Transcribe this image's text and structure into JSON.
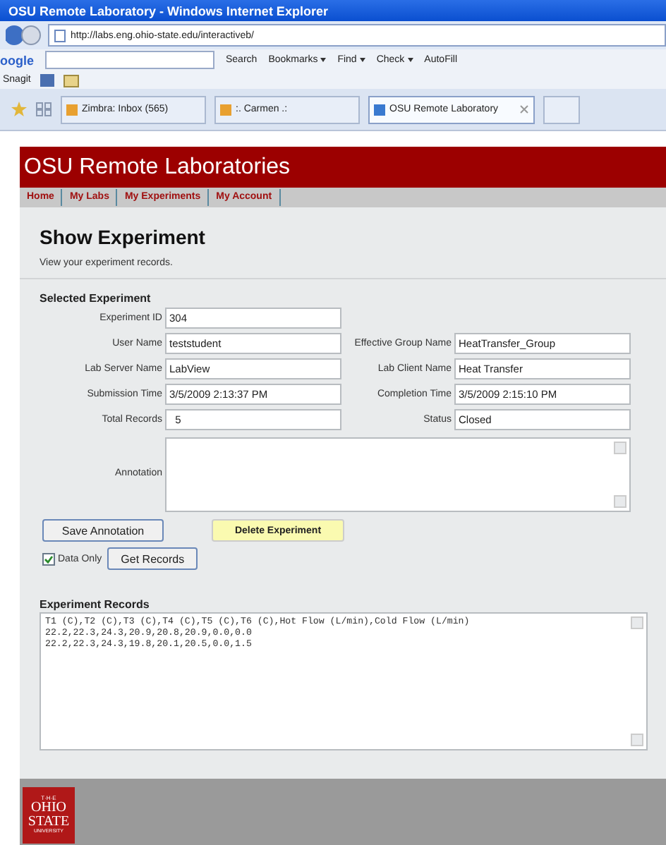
{
  "window": {
    "title": "OSU Remote Laboratory - Windows Internet Explorer"
  },
  "address_bar": {
    "url": "http://labs.eng.ohio-state.edu/interactiveb/"
  },
  "google_toolbar": {
    "logo": "oogle",
    "items": [
      {
        "label": "Search",
        "menu": false
      },
      {
        "label": "Bookmarks",
        "menu": true
      },
      {
        "label": "Find",
        "menu": true
      },
      {
        "label": "Check",
        "menu": true
      },
      {
        "label": "AutoFill",
        "menu": false
      }
    ]
  },
  "links_bar": {
    "items": [
      "Snagit"
    ]
  },
  "browser_tabs": [
    {
      "label": "Zimbra: Inbox (565)",
      "selected": false
    },
    {
      "label": ":. Carmen .:",
      "selected": false
    },
    {
      "label": "OSU Remote Laboratory",
      "selected": true
    }
  ],
  "site": {
    "title": "OSU Remote Laboratories",
    "nav": [
      "Home",
      "My Labs",
      "My Experiments",
      "My Account"
    ]
  },
  "page": {
    "heading": "Show Experiment",
    "description": "View your experiment records.",
    "section": "Selected Experiment",
    "rows": [
      [
        {
          "label": "Experiment ID",
          "value": "304"
        }
      ],
      [
        {
          "label": "User Name",
          "value": "teststudent"
        },
        {
          "label": "Effective Group Name",
          "value": "HeatTransfer_Group"
        }
      ],
      [
        {
          "label": "Lab Server Name",
          "value": "LabView"
        },
        {
          "label": "Lab Client Name",
          "value": "Heat Transfer"
        }
      ],
      [
        {
          "label": "Submission Time",
          "value": "3/5/2009 2:13:37 PM"
        },
        {
          "label": "Completion Time",
          "value": "3/5/2009 2:15:10 PM"
        }
      ],
      [
        {
          "label": "Total Records",
          "value": "  5"
        },
        {
          "label": "Status",
          "value": "Closed"
        }
      ]
    ],
    "annotation": {
      "label": "Annotation"
    },
    "buttons": [
      {
        "label": "Save Annotation",
        "kind": "normal"
      },
      {
        "label": "Delete Experiment",
        "kind": "warning"
      }
    ],
    "data_only": {
      "label": "Data Only",
      "checked": true
    },
    "get_records": {
      "label": "Get Records"
    },
    "records": {
      "heading": "Experiment Records",
      "lines": [
        "T1 (C),T2 (C),T3 (C),T4 (C),T5 (C),T6 (C),Hot Flow (L/min),Cold Flow (L/min)",
        "22.2,22.3,24.3,20.9,20.8,20.9,0.0,0.0",
        "22.2,22.3,24.3,19.8,20.1,20.5,0.0,1.5"
      ]
    }
  },
  "footer": {
    "logo_lines": [
      "T·H·E",
      "OHIO",
      "STATE",
      "UNIVERSITY"
    ]
  }
}
